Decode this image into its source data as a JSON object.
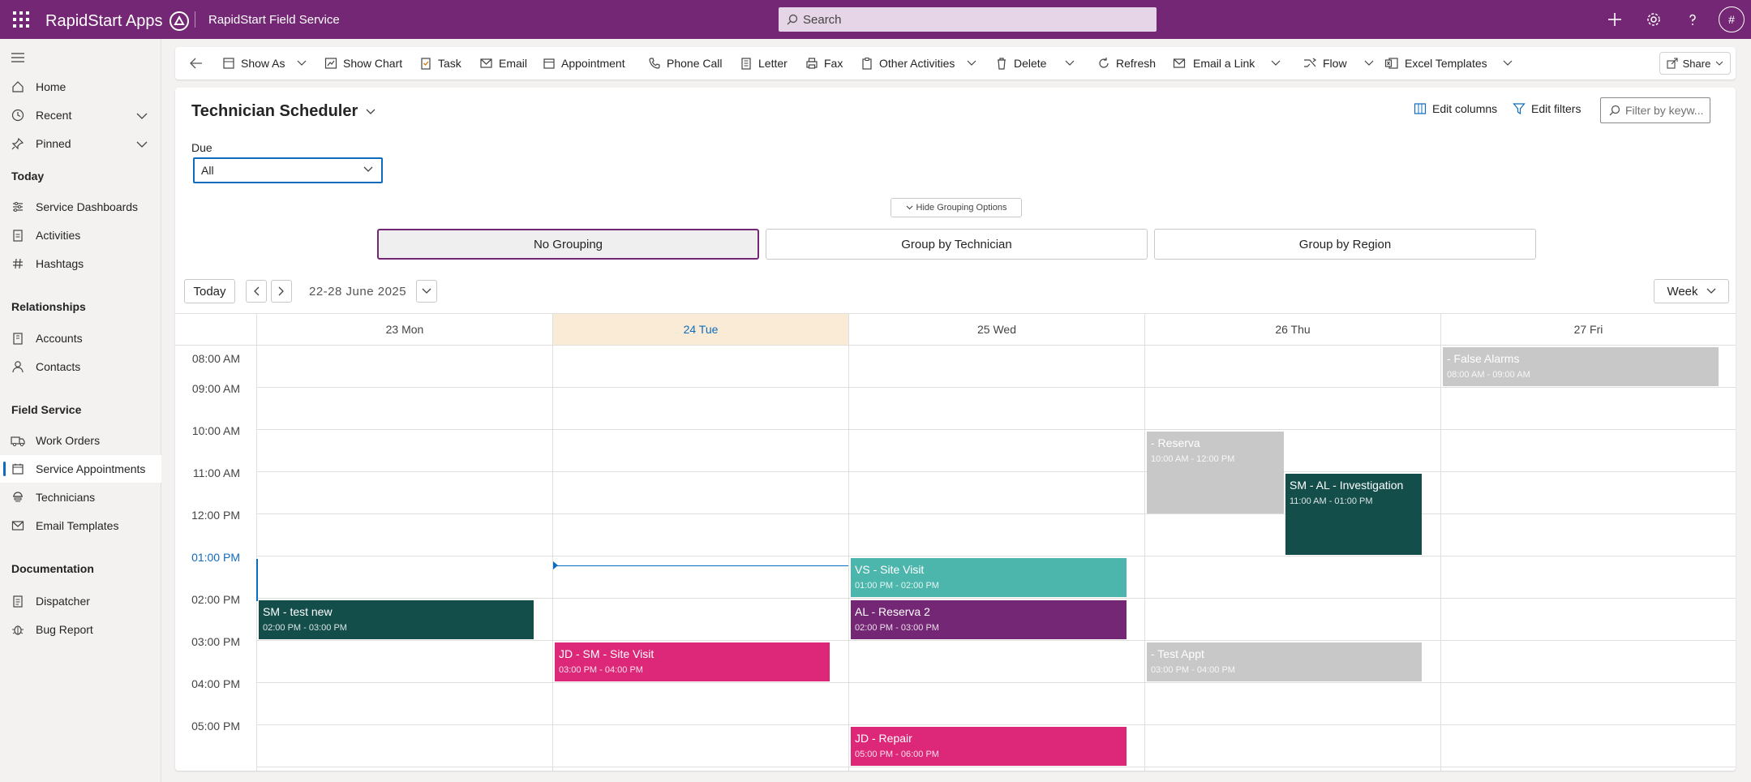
{
  "topbar": {
    "brand": "RapidStart Apps",
    "app_name": "RapidStart Field Service",
    "search_placeholder": "Search",
    "avatar_initial": "#"
  },
  "sidebar": {
    "items": [
      {
        "label": "Home",
        "icon": "home-icon"
      },
      {
        "label": "Recent",
        "icon": "clock-icon"
      },
      {
        "label": "Pinned",
        "icon": "pin-icon"
      }
    ],
    "sections": [
      {
        "title": "Today",
        "items": [
          "Service Dashboards",
          "Activities",
          "Hashtags"
        ]
      },
      {
        "title": "Relationships",
        "items": [
          "Accounts",
          "Contacts"
        ]
      },
      {
        "title": "Field Service",
        "items": [
          "Work Orders",
          "Service Appointments",
          "Technicians",
          "Email Templates"
        ]
      },
      {
        "title": "Documentation",
        "items": [
          "Dispatcher",
          "Bug Report"
        ]
      }
    ],
    "active": "Service Appointments"
  },
  "commands": {
    "show_as": "Show As",
    "show_chart": "Show Chart",
    "task": "Task",
    "email": "Email",
    "appointment": "Appointment",
    "phone_call": "Phone Call",
    "letter": "Letter",
    "fax": "Fax",
    "other_activities": "Other Activities",
    "delete": "Delete",
    "refresh": "Refresh",
    "email_link": "Email a Link",
    "flow": "Flow",
    "excel_templates": "Excel Templates",
    "share": "Share"
  },
  "view": {
    "title": "Technician Scheduler",
    "edit_columns": "Edit columns",
    "edit_filters": "Edit filters",
    "filter_placeholder": "Filter by keyw...",
    "due_label": "Due",
    "due_value": "All",
    "hide_grouping": "Hide Grouping Options",
    "grouping": [
      "No Grouping",
      "Group by Technician",
      "Group by Region"
    ],
    "active_grouping": "No Grouping"
  },
  "calendar": {
    "today_label": "Today",
    "range": "22-28 June 2025",
    "view_mode": "Week",
    "days": [
      "23 Mon",
      "24 Tue",
      "25 Wed",
      "26 Thu",
      "27 Fri"
    ],
    "today_day": "24 Tue",
    "times": [
      "08:00 AM",
      "09:00 AM",
      "10:00 AM",
      "11:00 AM",
      "12:00 PM",
      "01:00 PM",
      "02:00 PM",
      "03:00 PM",
      "04:00 PM",
      "05:00 PM"
    ],
    "current_time": "01:00 PM",
    "events": [
      {
        "title": "- False Alarms",
        "time": "08:00 AM - 09:00 AM",
        "color": "#c8c8c8"
      },
      {
        "title": "- Reserva",
        "time": "10:00 AM - 12:00 PM",
        "color": "#c8c8c8"
      },
      {
        "title": "SM - AL - Investigation",
        "time": "11:00 AM - 01:00 PM",
        "color": "#134e4a"
      },
      {
        "title": "VS - Site Visit",
        "time": "01:00 PM - 02:00 PM",
        "color": "#4db6ac"
      },
      {
        "title": "SM - test new",
        "time": "02:00 PM - 03:00 PM",
        "color": "#134e4a"
      },
      {
        "title": "AL - Reserva 2",
        "time": "02:00 PM - 03:00 PM",
        "color": "#742774"
      },
      {
        "title": "JD - SM - Site Visit",
        "time": "03:00 PM - 04:00 PM",
        "color": "#dd2879"
      },
      {
        "title": "- Test Appt",
        "time": "03:00 PM - 04:00 PM",
        "color": "#c8c8c8"
      },
      {
        "title": "JD - Repair",
        "time": "05:00 PM - 06:00 PM",
        "color": "#dd2879"
      }
    ]
  }
}
